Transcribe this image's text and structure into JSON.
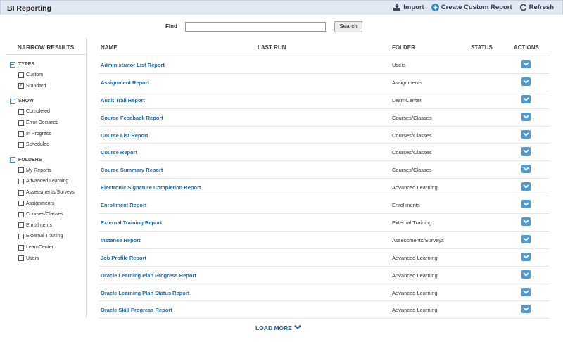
{
  "header": {
    "title": "BI Reporting",
    "actions": [
      {
        "label": "Import",
        "icon": "import-icon"
      },
      {
        "label": "Create Custom Report",
        "icon": "plus-circle-icon"
      },
      {
        "label": "Refresh",
        "icon": "refresh-icon"
      }
    ]
  },
  "search": {
    "label": "Find",
    "value": "",
    "placeholder": "",
    "button_label": "Search"
  },
  "sidebar": {
    "heading": "NARROW RESULTS",
    "groups": [
      {
        "title": "TYPES",
        "items": [
          {
            "label": "Custom",
            "checked": false
          },
          {
            "label": "Standard",
            "checked": true
          }
        ]
      },
      {
        "title": "SHOW",
        "items": [
          {
            "label": "Completed",
            "checked": false
          },
          {
            "label": "Error Occurred",
            "checked": false
          },
          {
            "label": "In Progress",
            "checked": false
          },
          {
            "label": "Scheduled",
            "checked": false
          }
        ]
      },
      {
        "title": "FOLDERS",
        "items": [
          {
            "label": "My Reports",
            "checked": false
          },
          {
            "label": "Advanced Learning",
            "checked": false
          },
          {
            "label": "Assessments/Surveys",
            "checked": false
          },
          {
            "label": "Assignments",
            "checked": false
          },
          {
            "label": "Courses/Classes",
            "checked": false
          },
          {
            "label": "Enrollments",
            "checked": false
          },
          {
            "label": "External Training",
            "checked": false
          },
          {
            "label": "LearnCenter",
            "checked": false
          },
          {
            "label": "Users",
            "checked": false
          }
        ]
      }
    ]
  },
  "table": {
    "columns": [
      "NAME",
      "LAST RUN",
      "FOLDER",
      "STATUS",
      "ACTIONS"
    ],
    "rows": [
      {
        "name": "Administrator List Report",
        "last_run": "",
        "folder": "Users",
        "status": ""
      },
      {
        "name": "Assignment Report",
        "last_run": "",
        "folder": "Assignments",
        "status": ""
      },
      {
        "name": "Audit Trail Report",
        "last_run": "",
        "folder": "LearnCenter",
        "status": ""
      },
      {
        "name": "Course Feedback Report",
        "last_run": "",
        "folder": "Courses/Classes",
        "status": ""
      },
      {
        "name": "Course List Report",
        "last_run": "",
        "folder": "Courses/Classes",
        "status": ""
      },
      {
        "name": "Course Report",
        "last_run": "",
        "folder": "Courses/Classes",
        "status": ""
      },
      {
        "name": "Course Summary Report",
        "last_run": "",
        "folder": "Courses/Classes",
        "status": ""
      },
      {
        "name": "Electronic Signature Completion Report",
        "last_run": "",
        "folder": "Advanced Learning",
        "status": ""
      },
      {
        "name": "Enrollment Report",
        "last_run": "",
        "folder": "Enrollments",
        "status": ""
      },
      {
        "name": "External Training Report",
        "last_run": "",
        "folder": "External Training",
        "status": ""
      },
      {
        "name": "Instance Report",
        "last_run": "",
        "folder": "Assessments/Surveys",
        "status": ""
      },
      {
        "name": "Job Profile Report",
        "last_run": "",
        "folder": "Advanced Learning",
        "status": ""
      },
      {
        "name": "Oracle Learning Plan Progress Report",
        "last_run": "",
        "folder": "Advanced Learning",
        "status": ""
      },
      {
        "name": "Oracle Learning Plan Status Report",
        "last_run": "",
        "folder": "Advanced Learning",
        "status": ""
      },
      {
        "name": "Oracle Skill Progress Report",
        "last_run": "",
        "folder": "Advanced Learning",
        "status": ""
      }
    ]
  },
  "footer": {
    "load_more_label": "LOAD MORE"
  },
  "colors": {
    "accent": "#4a9bd6",
    "link": "#1f6aab",
    "header_bg": "#e3e9f2"
  }
}
